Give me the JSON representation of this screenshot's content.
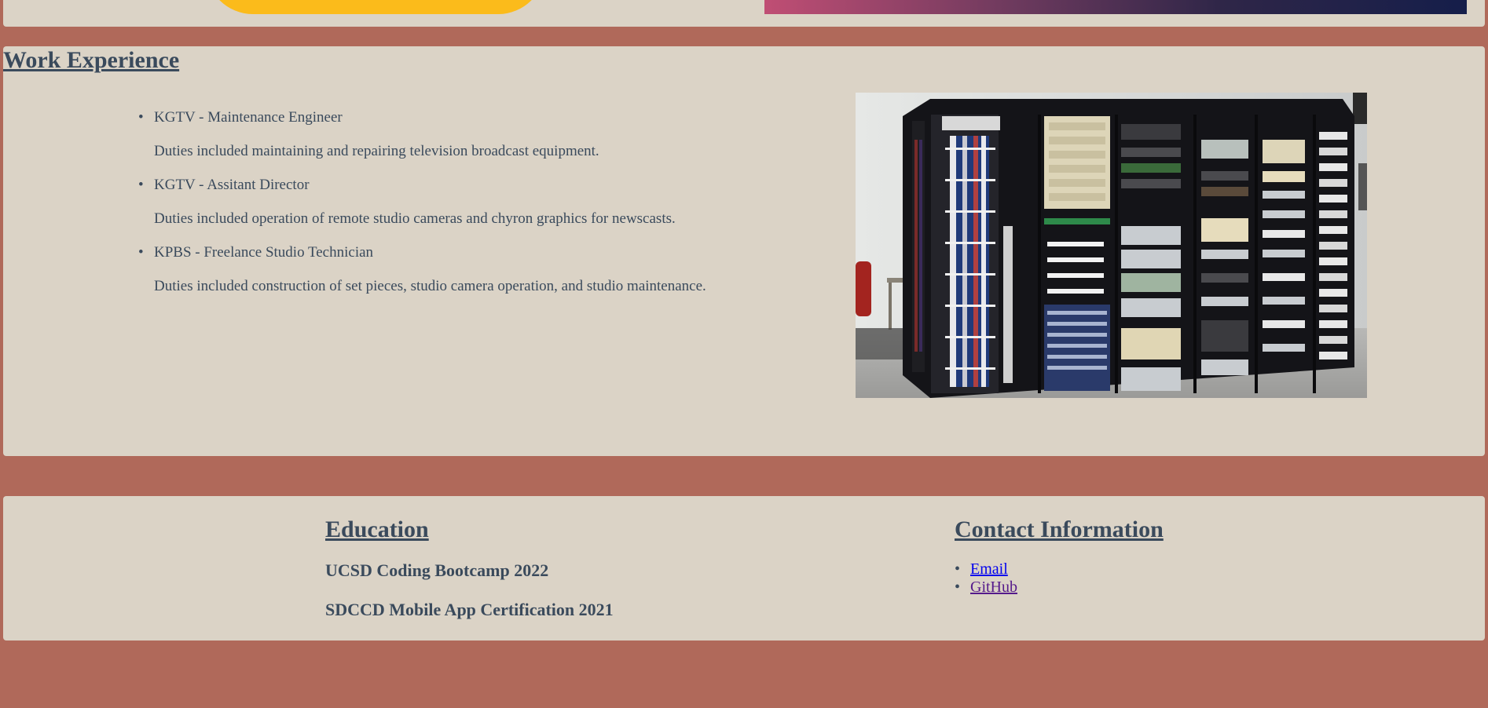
{
  "work": {
    "heading": "Work Experience",
    "jobs": [
      {
        "title": "KGTV - Maintenance Engineer",
        "duties": "Duties included maintaining and repairing television broadcast equipment."
      },
      {
        "title": "KGTV - Assitant Director",
        "duties": "Duties included operation of remote studio cameras and chyron graphics for newscasts."
      },
      {
        "title": "KPBS - Freelance Studio Technician",
        "duties": "Duties included construction of set pieces, studio camera operation, and studio maintenance."
      }
    ]
  },
  "education": {
    "heading": "Education",
    "items": [
      "UCSD Coding Bootcamp 2022",
      "SDCCD Mobile App Certification 2021"
    ]
  },
  "contact": {
    "heading": "Contact Information",
    "links": [
      "Email",
      "GitHub"
    ]
  },
  "colors": {
    "background": "#b0695a",
    "panel": "#dbd3c6",
    "text": "#3a4a5c",
    "accent_yellow": "#fbbb1b"
  }
}
